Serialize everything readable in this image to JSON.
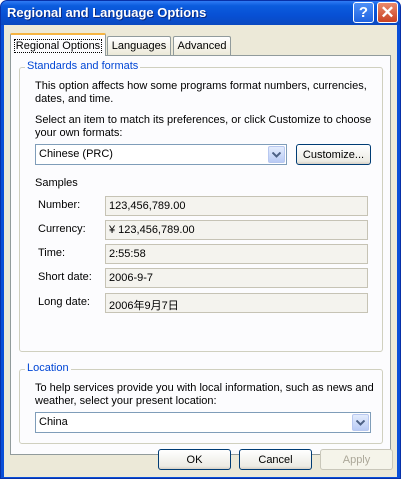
{
  "window": {
    "title": "Regional and Language Options",
    "help_label": "?",
    "close_label": "✕"
  },
  "tabs": [
    {
      "label": "Regional Options",
      "active": true
    },
    {
      "label": "Languages",
      "active": false
    },
    {
      "label": "Advanced",
      "active": false
    }
  ],
  "standards": {
    "group_title": "Standards and formats",
    "description_line1": "This option affects how some programs format numbers, currencies,",
    "description_line2": "dates, and time.",
    "select_line1": "Select an item to match its preferences, or click Customize to choose",
    "select_line2": "your own formats:",
    "format_value": "Chinese (PRC)",
    "customize_label": "Customize...",
    "samples_heading": "Samples",
    "samples": [
      {
        "label": "Number:",
        "value": "123,456,789.00"
      },
      {
        "label": "Currency:",
        "value": "¥ 123,456,789.00"
      },
      {
        "label": "Time:",
        "value": "2:55:58"
      },
      {
        "label": "Short date:",
        "value": "2006-9-7"
      },
      {
        "label": "Long date:",
        "value": "2006年9月7日"
      }
    ]
  },
  "location": {
    "group_title": "Location",
    "description_line1": "To help services provide you with local information, such as news and",
    "description_line2": "weather, select your present location:",
    "value": "China"
  },
  "footer": {
    "ok_label": "OK",
    "cancel_label": "Cancel",
    "apply_label": "Apply"
  },
  "colors": {
    "titlebar": "#0a4fd8",
    "group_title": "#0046d5",
    "dialog_bg": "#ece9d8",
    "active_tab_accent": "#f5b443"
  },
  "icons": {
    "help": "question-mark-icon",
    "close": "close-icon",
    "dropdown": "chevron-down-icon"
  }
}
